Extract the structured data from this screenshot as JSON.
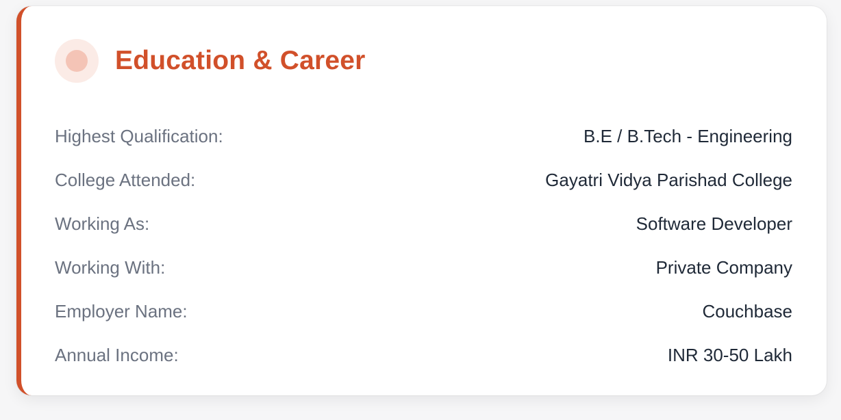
{
  "card": {
    "title": "Education & Career",
    "icon": "circle-dot-icon",
    "accent_color": "#d1502a",
    "rows": [
      {
        "label": "Highest Qualification:",
        "value": "B.E / B.Tech - Engineering"
      },
      {
        "label": "College Attended:",
        "value": "Gayatri Vidya Parishad College"
      },
      {
        "label": "Working As:",
        "value": "Software Developer"
      },
      {
        "label": "Working With:",
        "value": "Private Company"
      },
      {
        "label": "Employer Name:",
        "value": "Couchbase"
      },
      {
        "label": "Annual Income:",
        "value": "INR 30-50 Lakh"
      }
    ]
  }
}
